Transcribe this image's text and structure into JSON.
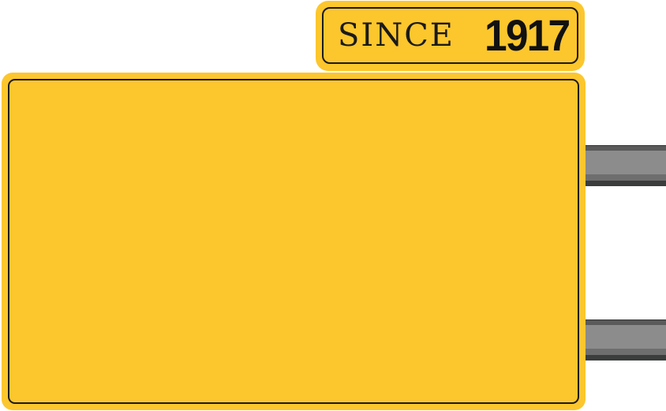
{
  "sign": {
    "since_word": "SINCE",
    "since_year": "1917"
  },
  "colors": {
    "sign_yellow": "#fcc62d",
    "outline": "#1a1a1a",
    "bracket_gray": "#8c8c8c",
    "bracket_dark": "#3a3d3c"
  }
}
